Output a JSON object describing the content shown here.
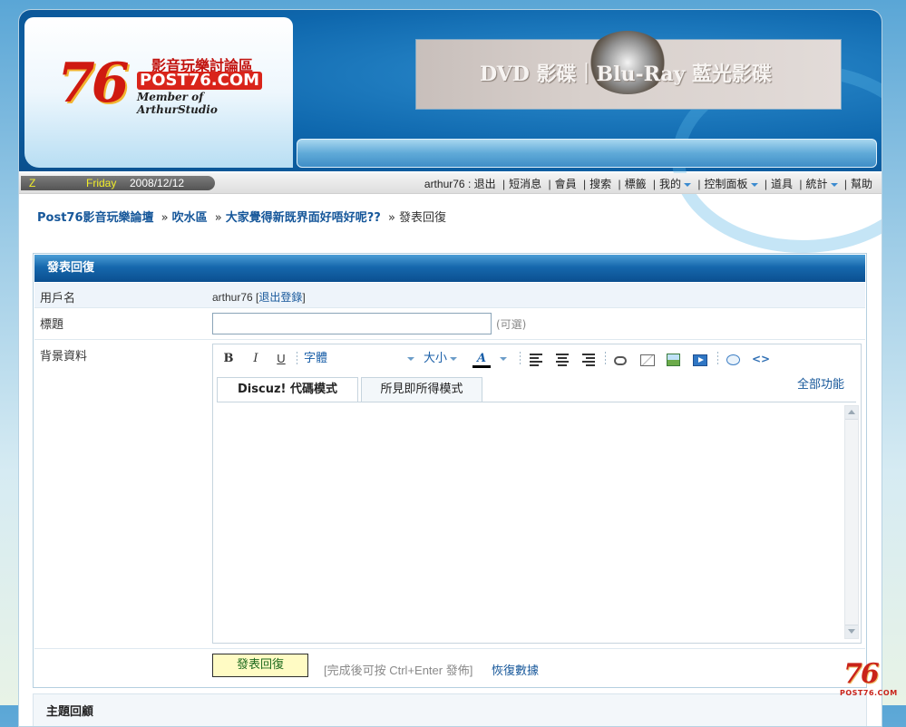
{
  "logo": {
    "numeral": "76",
    "name_cn": "影音玩樂討論區",
    "domain": "POST76.COM",
    "member": "Member of ArthurStudio"
  },
  "banner": {
    "text": "DVD 影碟｜Blu-Ray 藍光影碟"
  },
  "infobar": {
    "z": "Z",
    "day": "Friday",
    "date": "2008/12/12",
    "user": "arthur76",
    "user_sep": ":",
    "menu": [
      "退出",
      "短消息",
      "會員",
      "搜索",
      "標籤",
      "我的",
      "控制面板",
      "道具",
      "統計",
      "幫助"
    ]
  },
  "breadcrumb": {
    "home": "Post76影音玩樂論壇",
    "forum": "吹水區",
    "thread": "大家覺得新既界面好唔好呢??",
    "current": "發表回復",
    "sep": "»"
  },
  "form": {
    "header": "發表回復",
    "username_label": "用戶名",
    "username_value": "arthur76",
    "logout_link": "退出登錄",
    "title_label": "標題",
    "title_value": "",
    "title_optional": "(可選)",
    "body_label": "背景資料"
  },
  "editor": {
    "bold": "B",
    "italic": "I",
    "underline": "U",
    "font_select": "字體",
    "size_select": "大小",
    "color_glyph": "A",
    "tabs": [
      "Discuz! 代碼模式",
      "所見即所得模式"
    ],
    "all_functions": "全部功能",
    "content": ""
  },
  "submit": {
    "button": "發表回復",
    "hint": "[完成後可按  Ctrl+Enter 發佈]",
    "restore": "恢復數據"
  },
  "next_section": {
    "title": "主題回顧"
  },
  "watermark": {
    "numeral": "76",
    "text": "POST76.COM"
  },
  "colors": {
    "link": "#16579a",
    "header_blue": "#0b4f90",
    "submit_bg": "#fffbc4"
  }
}
